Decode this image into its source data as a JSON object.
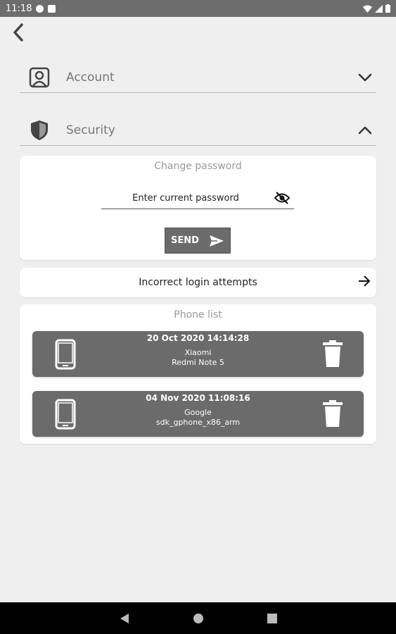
{
  "status_bar": {
    "time": "11:18"
  },
  "sections": {
    "account": {
      "label": "Account"
    },
    "security": {
      "label": "Security"
    }
  },
  "change_password": {
    "title": "Change password",
    "placeholder": "Enter current password",
    "send_label": "SEND"
  },
  "login_attempts": {
    "label": "Incorrect login attempts"
  },
  "phone_list": {
    "title": "Phone list",
    "items": [
      {
        "date": "20 Oct 2020  14:14:28",
        "brand": "Xiaomi",
        "model": "Redmi Note 5"
      },
      {
        "date": "04 Nov 2020  11:08:16",
        "brand": "Google",
        "model": "sdk_gphone_x86_arm"
      }
    ]
  },
  "colors": {
    "status_bar": "#6d6d6d",
    "background": "#efefef",
    "accent_gray": "#6b6b6b",
    "nav_bar": "#000000"
  },
  "icons": {
    "back": "chevron-left-icon",
    "account": "user-icon",
    "security": "shield-icon",
    "visibility": "eye-off-icon",
    "send": "send-icon",
    "phone": "phone-icon",
    "delete": "trash-icon"
  }
}
